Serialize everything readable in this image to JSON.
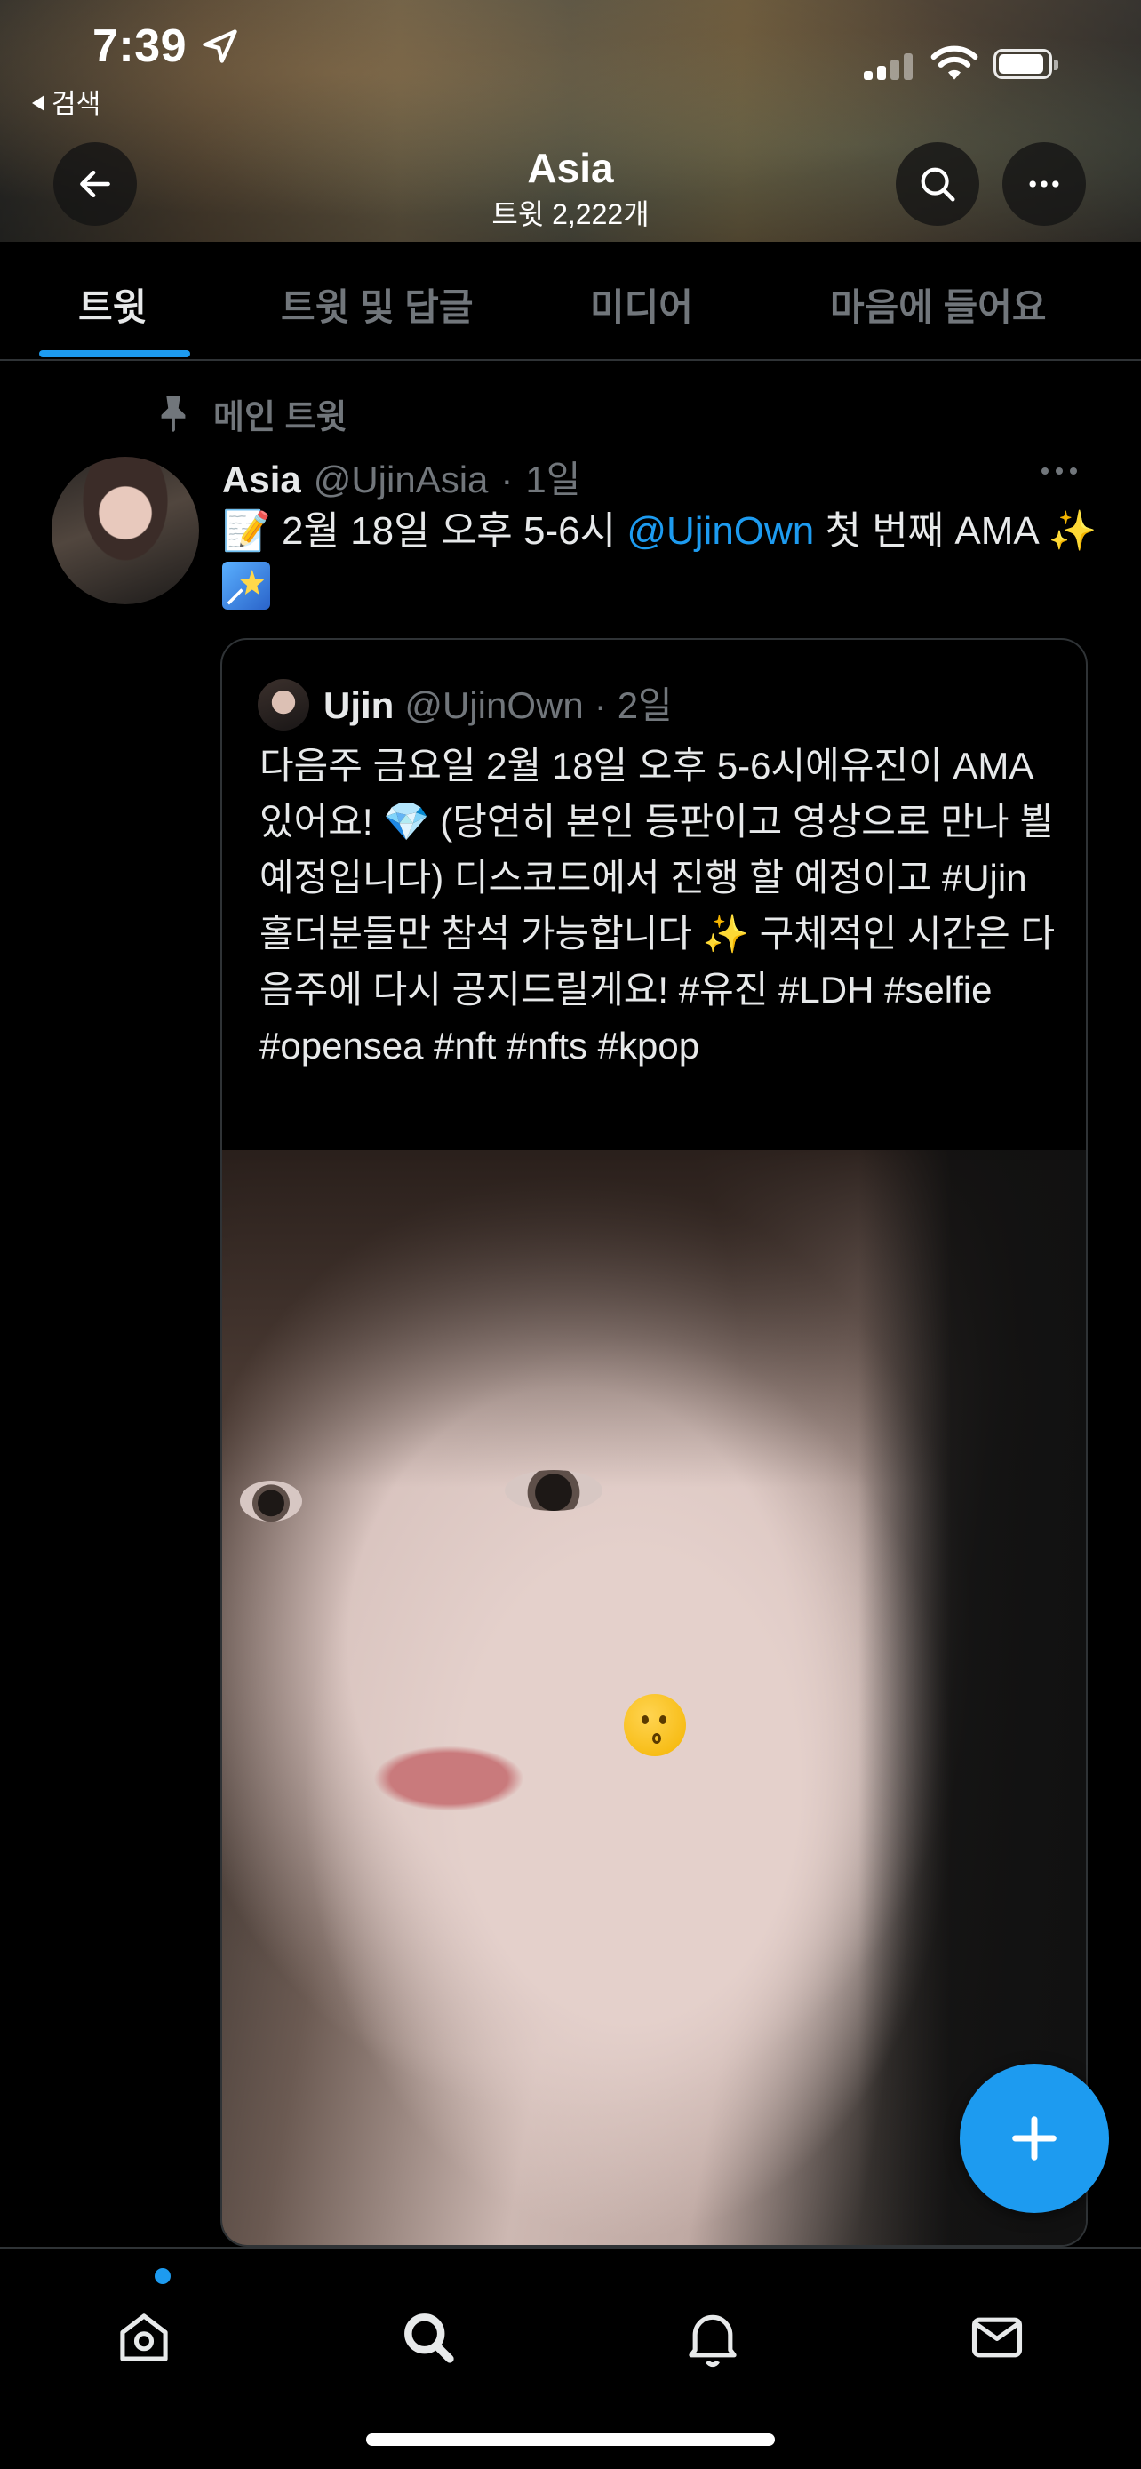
{
  "status_bar": {
    "time": "7:39",
    "back_app_label": "검색"
  },
  "profile": {
    "name": "Asia",
    "tweet_count": "트윗 2,222개"
  },
  "tabs": [
    {
      "label": "트윗",
      "active": true
    },
    {
      "label": "트윗 및 답글",
      "active": false
    },
    {
      "label": "미디어",
      "active": false
    },
    {
      "label": "마음에 들어요",
      "active": false
    }
  ],
  "pinned": {
    "label": "메인 트윗",
    "author_name": "Asia",
    "author_handle": "@UjinAsia",
    "separator": "·",
    "time": "1일",
    "text_part1": "📝 2월 18일 오후 5-6시 ",
    "mention": "@UjinOwn",
    "text_part2": " 첫 번째 AMA ✨"
  },
  "quoted": {
    "author_name": "Ujin",
    "author_handle": "@UjinOwn",
    "separator": "·",
    "time": "2일",
    "text": "다음주 금요일 2월 18일 오후 5-6시에유진이 AMA 있어요! 💎 (당연히 본인 등판이고 영상으로 만나 뵐 예정입니다) 디스코드에서 진행 할 예정이고 #Ujin 홀더분들만 참석 가능합니다 ✨ 구체적인 시간은 다음주에 다시 공지드릴게요! #유진 #LDH #selfie #opensea #nft #nfts #kpop"
  },
  "icons": {
    "back": "arrow-left-icon",
    "search": "search-icon",
    "more": "more-horizontal-icon",
    "pin": "pin-icon",
    "compose": "plus-icon",
    "home": "home-icon",
    "explore": "search-icon",
    "notifications": "bell-icon",
    "messages": "mail-icon"
  },
  "colors": {
    "accent": "#1d9bf0",
    "background": "#000000",
    "secondary_text": "#71767b"
  }
}
